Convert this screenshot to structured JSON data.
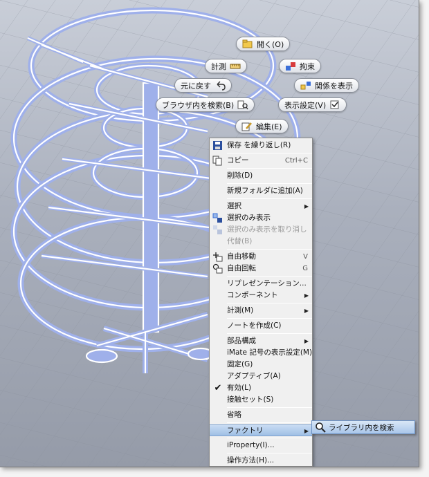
{
  "marking_menu": {
    "open": "開く(O)",
    "measure": "計測",
    "constrain": "拘束",
    "undo": "元に戻す",
    "show_relations": "関係を表示",
    "find_in_browser": "ブラウザ内を検索(B)",
    "display_settings": "表示設定(V)",
    "edit": "編集(E)"
  },
  "context_menu": {
    "items": [
      {
        "label": "保存 を繰り返し(R)",
        "shortcut": "",
        "icon": "save-icon"
      },
      {
        "label": "コピー",
        "shortcut": "Ctrl+C",
        "icon": "copy-icon"
      },
      {
        "label": "削除(D)",
        "shortcut": ""
      },
      {
        "label": "新規フォルダに追加(A)",
        "shortcut": ""
      },
      {
        "label": "選択",
        "shortcut": ""
      },
      {
        "label": "選択のみ表示",
        "shortcut": "",
        "icon": "isolate-icon"
      },
      {
        "label": "選択のみ表示を取り消し",
        "shortcut": "",
        "icon": "undo-isolate-icon"
      },
      {
        "label": "代替(B)",
        "shortcut": ""
      },
      {
        "label": "自由移動",
        "shortcut": "V",
        "icon": "free-move-icon"
      },
      {
        "label": "自由回転",
        "shortcut": "G",
        "icon": "free-rotate-icon"
      },
      {
        "label": "リプレゼンテーション...",
        "shortcut": ""
      },
      {
        "label": "コンポーネント",
        "shortcut": ""
      },
      {
        "label": "計測(M)",
        "shortcut": ""
      },
      {
        "label": "ノートを作成(C)",
        "shortcut": ""
      },
      {
        "label": "部品構成",
        "shortcut": ""
      },
      {
        "label": "iMate 記号の表示設定(M)",
        "shortcut": ""
      },
      {
        "label": "固定(G)",
        "shortcut": ""
      },
      {
        "label": "アダプティブ(A)",
        "shortcut": ""
      },
      {
        "label": "有効(L)",
        "shortcut": ""
      },
      {
        "label": "接触セット(S)",
        "shortcut": ""
      },
      {
        "label": "省略",
        "shortcut": ""
      },
      {
        "label": "ファクトリ",
        "shortcut": ""
      },
      {
        "label": "iProperty(I)...",
        "shortcut": ""
      },
      {
        "label": "操作方法(H)...",
        "shortcut": ""
      }
    ]
  },
  "submenu": {
    "label": "ライブラリ内を検索"
  },
  "colors": {
    "model_blue": "#9fb0ea",
    "model_edge": "#ffffff",
    "viewport_bg": "#aab0bd",
    "highlight": "#a9c6ea"
  }
}
